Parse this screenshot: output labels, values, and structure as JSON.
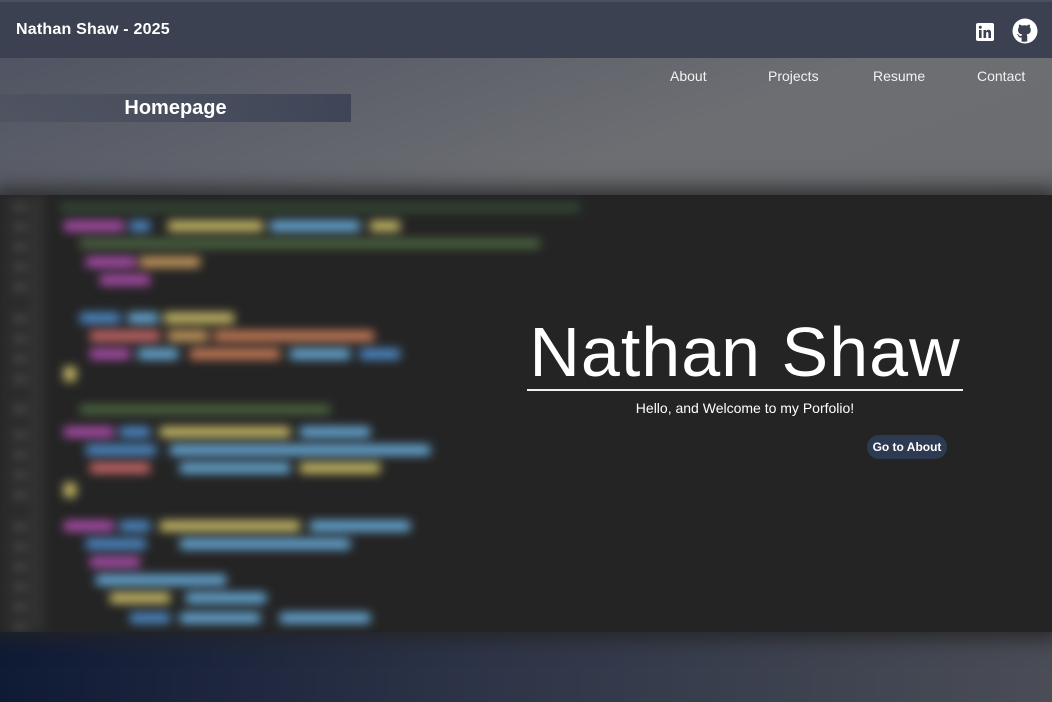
{
  "header": {
    "brand": "Nathan Shaw - 2025",
    "social": [
      {
        "icon": "linkedin-icon"
      },
      {
        "icon": "github-icon"
      }
    ]
  },
  "nav": {
    "items": [
      {
        "label": "About"
      },
      {
        "label": "Projects"
      },
      {
        "label": "Resume"
      },
      {
        "label": "Contact"
      }
    ]
  },
  "page": {
    "label": "Homepage"
  },
  "hero": {
    "title": "Nathan Shaw",
    "subtitle": "Hello, and Welcome to my Porfolio!",
    "button_label": "Go to About"
  },
  "colors": {
    "header_bg": "#3b4150",
    "code_bg": "#242424",
    "button_bg": "#2e3a52",
    "text": "#ffffff"
  }
}
